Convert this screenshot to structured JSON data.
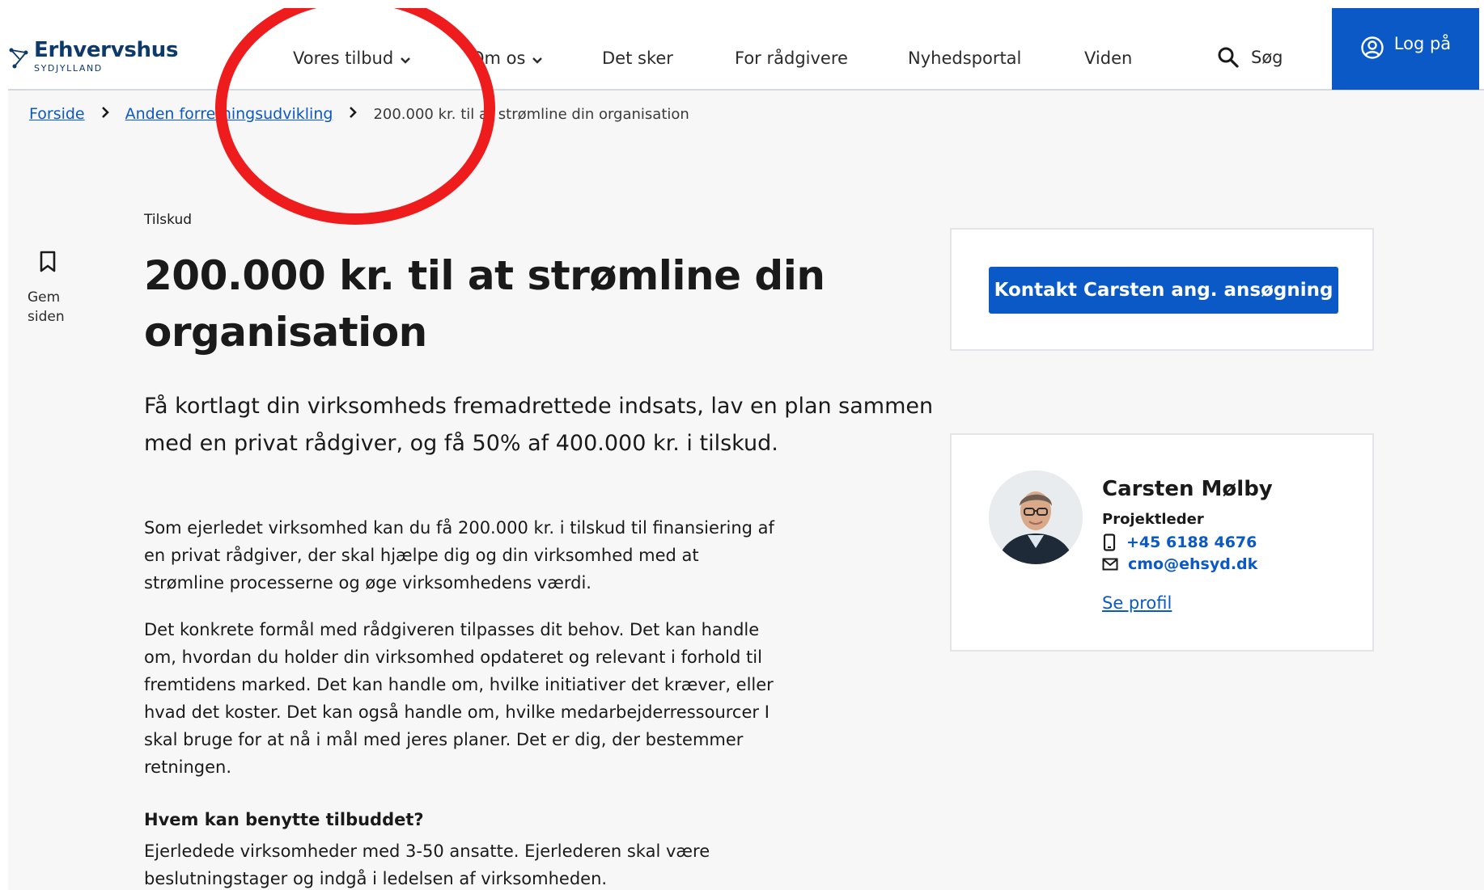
{
  "header": {
    "logo": {
      "name": "Erhvervshus",
      "tagline": "SYDJYLLAND"
    },
    "nav": [
      {
        "label": "Vores tilbud",
        "dropdown": true
      },
      {
        "label": "Om os",
        "dropdown": true
      },
      {
        "label": "Det sker",
        "dropdown": false
      },
      {
        "label": "For rådgivere",
        "dropdown": false
      },
      {
        "label": "Nyhedsportal",
        "dropdown": false
      },
      {
        "label": "Viden",
        "dropdown": false
      }
    ],
    "search_label": "Søg",
    "login_label": "Log på"
  },
  "breadcrumb": {
    "items": [
      "Forside",
      "Anden forretningsudvikling"
    ],
    "current": "200.000 kr. til at strømline din organisation"
  },
  "save_page": {
    "label": "Gem siden"
  },
  "article": {
    "eyebrow": "Tilskud",
    "title": "200.000 kr. til at strømline din organisation",
    "lead": "Få kortlagt din virksomheds fremadrettede indsats, lav en plan sammen med en privat rådgiver, og få 50% af 400.000 kr. i tilskud.",
    "paragraphs": [
      "Som ejerledet virksomhed kan du få 200.000 kr. i tilskud til finansiering af en privat rådgiver, der skal hjælpe dig og din virksomhed med at strømline processerne og øge virksomhedens værdi.",
      "Det konkrete formål med rådgiveren tilpasses dit behov. Det kan handle om, hvordan du holder din virksomhed opdateret og relevant i forhold til fremtidens marked. Det kan handle om, hvilke initiativer det kræver, eller hvad det koster. Det kan også handle om, hvilke medarbejderressourcer I skal bruge for at nå i mål med jeres planer. Det er dig, der bestemmer retningen."
    ],
    "who_heading": "Hvem kan benytte tilbuddet?",
    "who_text": "Ejerledede virksomheder med 3-50 ansatte. Ejerlederen skal være beslutningstager og indgå i ledelsen af virksomheden."
  },
  "sidebar": {
    "cta_label": "Kontakt Carsten ang. ansøgning",
    "contact": {
      "name": "Carsten Mølby",
      "role": "Projektleder",
      "phone": "+45 6188 4676",
      "email": "cmo@ehsyd.dk",
      "profile_link": "Se profil"
    }
  },
  "colors": {
    "accent": "#0a59c7",
    "logo": "#0e3a6b",
    "annotation": "#ee1c1c"
  },
  "icons": [
    "chevron-down-icon",
    "search-icon",
    "user-circle-icon",
    "chevron-right-icon",
    "bookmark-icon",
    "phone-icon",
    "mail-icon"
  ]
}
